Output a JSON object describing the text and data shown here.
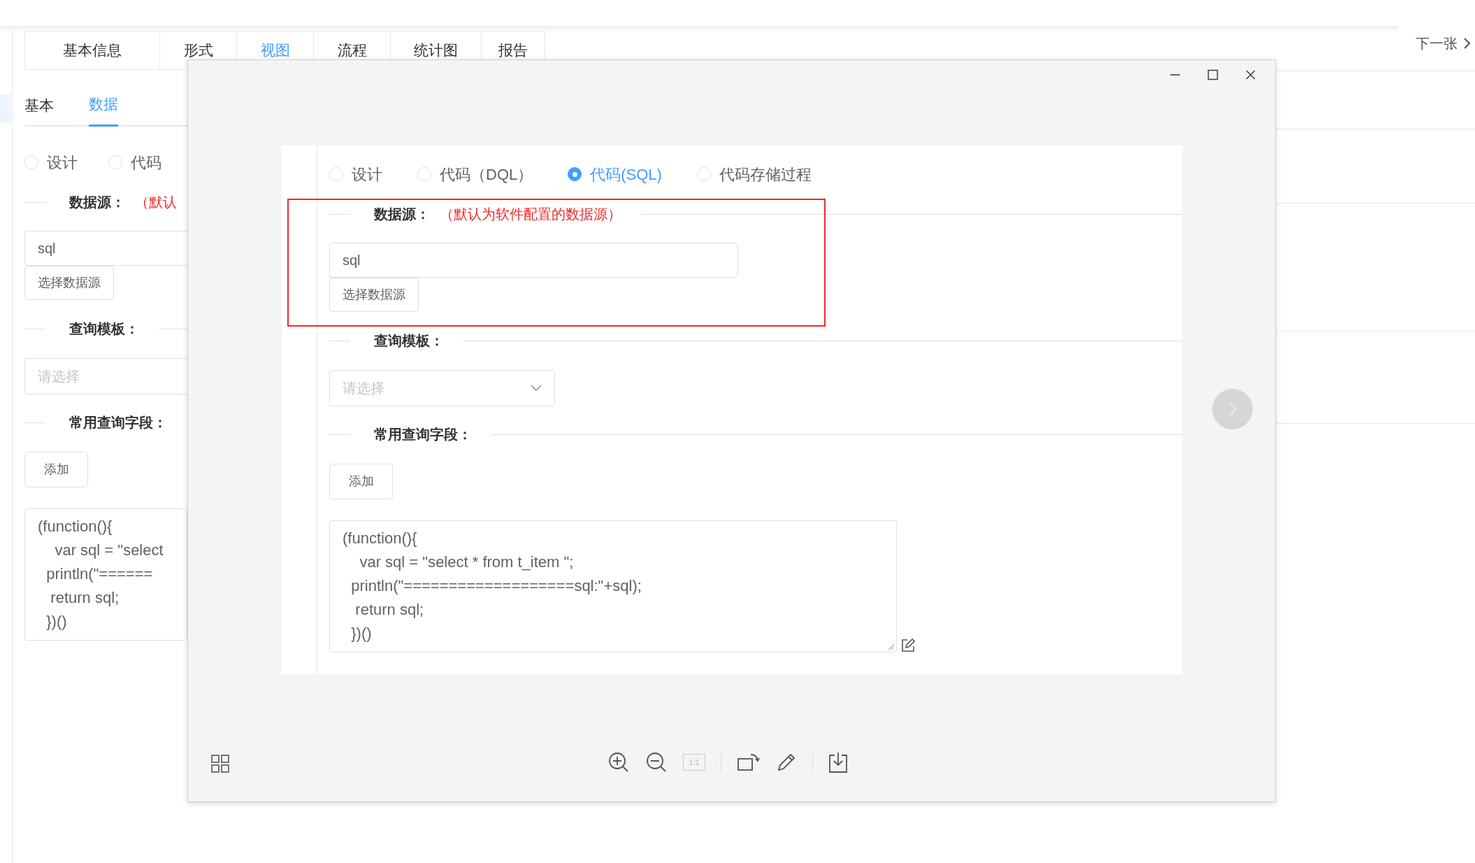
{
  "page": {
    "tabs": [
      {
        "label": "基本信息",
        "selected": false
      },
      {
        "label": "形式",
        "selected": false
      },
      {
        "label": "视图",
        "selected": true
      },
      {
        "label": "流程",
        "selected": false
      },
      {
        "label": "统计图",
        "selected": false
      },
      {
        "label": "报告",
        "selected": false
      }
    ],
    "next_link": "下一张",
    "subtabs": [
      {
        "label": "基本",
        "selected": false
      },
      {
        "label": "数据",
        "selected": true
      }
    ],
    "form": {
      "radios": [
        {
          "label": "设计",
          "selected": false
        },
        {
          "label": "代码",
          "selected": false
        }
      ],
      "datasource_label": "数据源：",
      "datasource_note": "（默认",
      "datasource_value": "sql",
      "choose_button": "选择数据源",
      "template_label": "查询模板：",
      "template_placeholder": "请选择",
      "fields_label": "常用查询字段：",
      "add_button": "添加",
      "code_lines": [
        "(function(){",
        "    var sql = \"select",
        "  println(\"======",
        "   return sql;",
        "  })()"
      ]
    }
  },
  "viewer": {
    "image": {
      "radios": [
        {
          "label": "设计",
          "selected": false
        },
        {
          "label": "代码（DQL）",
          "selected": false
        },
        {
          "label": "代码(SQL)",
          "selected": true
        },
        {
          "label": "代码存储过程",
          "selected": false
        }
      ],
      "datasource_label": "数据源：",
      "datasource_note": "（默认为软件配置的数据源）",
      "datasource_value": "sql",
      "choose_button": "选择数据源",
      "template_label": "查询模板：",
      "template_placeholder": "请选择",
      "fields_label": "常用查询字段：",
      "add_button": "添加",
      "code_lines": [
        "(function(){",
        "    var sql = \"select * from t_item \";",
        "  println(\"===================sql:\"+sql);",
        "   return sql;",
        "  })()"
      ]
    },
    "actual_size_button": {
      "label": "1:1",
      "disabled": true
    }
  }
}
